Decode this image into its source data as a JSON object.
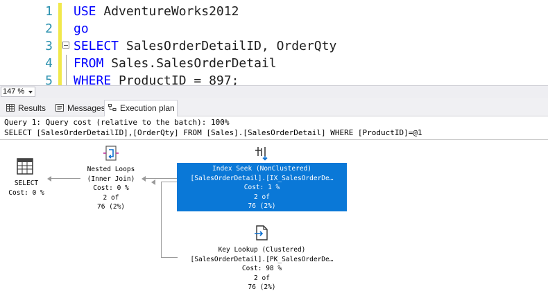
{
  "editor": {
    "lines": [
      {
        "num": "1",
        "kw1": "USE",
        "rest": " AdventureWorks2012"
      },
      {
        "num": "2",
        "kw1": "go",
        "rest": ""
      },
      {
        "num": "3",
        "kw1": "SELECT",
        "rest": " SalesOrderDetailID, OrderQty"
      },
      {
        "num": "4",
        "kw1": "FROM",
        "rest": " Sales.SalesOrderDetail"
      },
      {
        "num": "5",
        "kw1": "WHERE",
        "rest": " ProductID = 897;"
      }
    ]
  },
  "zoom": {
    "value": "147 %"
  },
  "tabs": [
    {
      "label": "Results"
    },
    {
      "label": "Messages"
    },
    {
      "label": "Execution plan"
    }
  ],
  "plan": {
    "query_cost": "Query 1: Query cost (relative to the batch): 100%",
    "query_text": "SELECT [SalesOrderDetailID],[OrderQty] FROM [Sales].[SalesOrderDetail] WHERE [ProductID]=@1",
    "nodes": {
      "select": {
        "name": "SELECT",
        "cost": "Cost: 0 %"
      },
      "nested": {
        "name": "Nested Loops",
        "sub": "(Inner Join)",
        "cost": "Cost: 0 %",
        "rows1": "2 of",
        "rows2": "76 (2%)"
      },
      "seek": {
        "name": "Index Seek (NonClustered)",
        "obj": "[SalesOrderDetail].[IX_SalesOrderDe…",
        "cost": "Cost: 1 %",
        "rows1": "2 of",
        "rows2": "76 (2%)"
      },
      "lookup": {
        "name": "Key Lookup (Clustered)",
        "obj": "[SalesOrderDetail].[PK_SalesOrderDe…",
        "cost": "Cost: 98 %",
        "rows1": "2 of",
        "rows2": "76 (2%)"
      }
    }
  },
  "colors": {
    "selection": "#0a78d7",
    "keyword": "#0000ff",
    "line_number": "#2b91af"
  }
}
